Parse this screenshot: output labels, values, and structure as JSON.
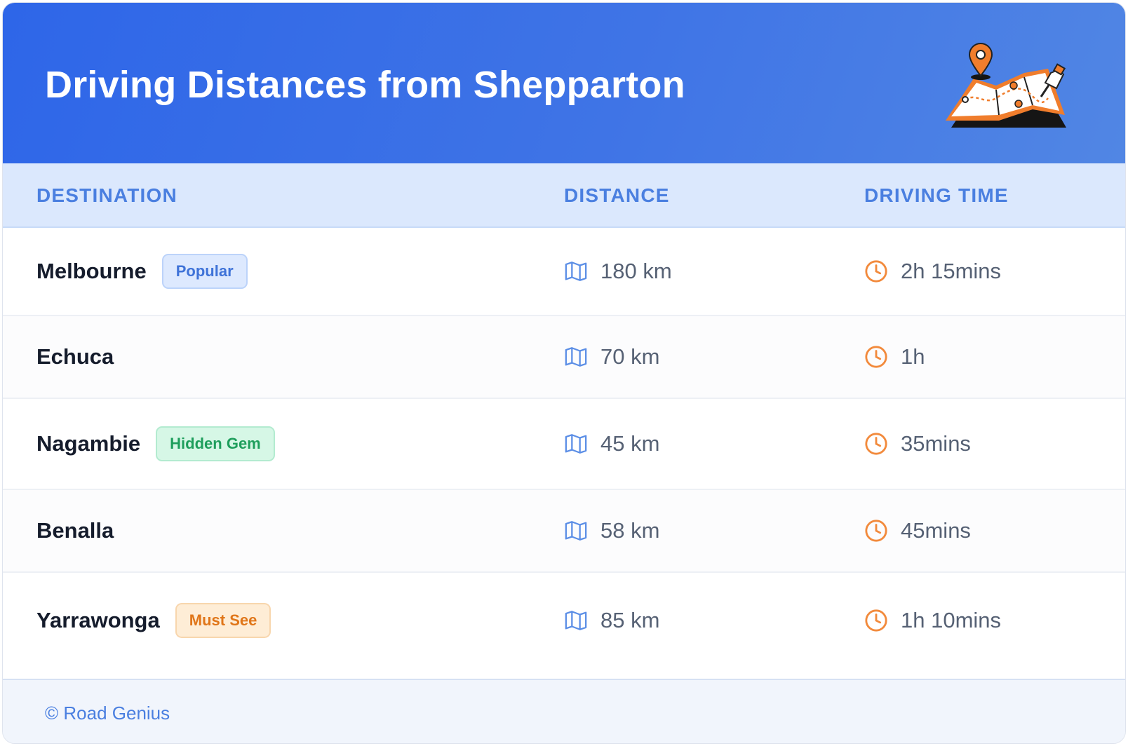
{
  "header": {
    "title": "Driving Distances from Shepparton",
    "illustration_icon": "map-with-pins-icon"
  },
  "table": {
    "columns": {
      "destination": "DESTINATION",
      "distance": "DISTANCE",
      "time": "DRIVING TIME"
    },
    "rows": [
      {
        "destination": "Melbourne",
        "badge": "Popular",
        "badge_style": "blue",
        "distance": "180 km",
        "time": "2h 15mins"
      },
      {
        "destination": "Echuca",
        "badge": "",
        "badge_style": "",
        "distance": "70 km",
        "time": "1h"
      },
      {
        "destination": "Nagambie",
        "badge": "Hidden Gem",
        "badge_style": "green",
        "distance": "45 km",
        "time": "35mins"
      },
      {
        "destination": "Benalla",
        "badge": "",
        "badge_style": "",
        "distance": "58 km",
        "time": "45mins"
      },
      {
        "destination": "Yarrawonga",
        "badge": "Must See",
        "badge_style": "orange",
        "distance": "85 km",
        "time": "1h 10mins"
      }
    ]
  },
  "icons": {
    "distance": "map-icon",
    "time": "clock-icon"
  },
  "footer": {
    "text": "© Road Genius"
  },
  "colors": {
    "header_gradient_start": "#2e66e8",
    "header_gradient_end": "#5186e4",
    "accent_blue": "#4a7fe0",
    "accent_orange": "#f28a3c"
  }
}
